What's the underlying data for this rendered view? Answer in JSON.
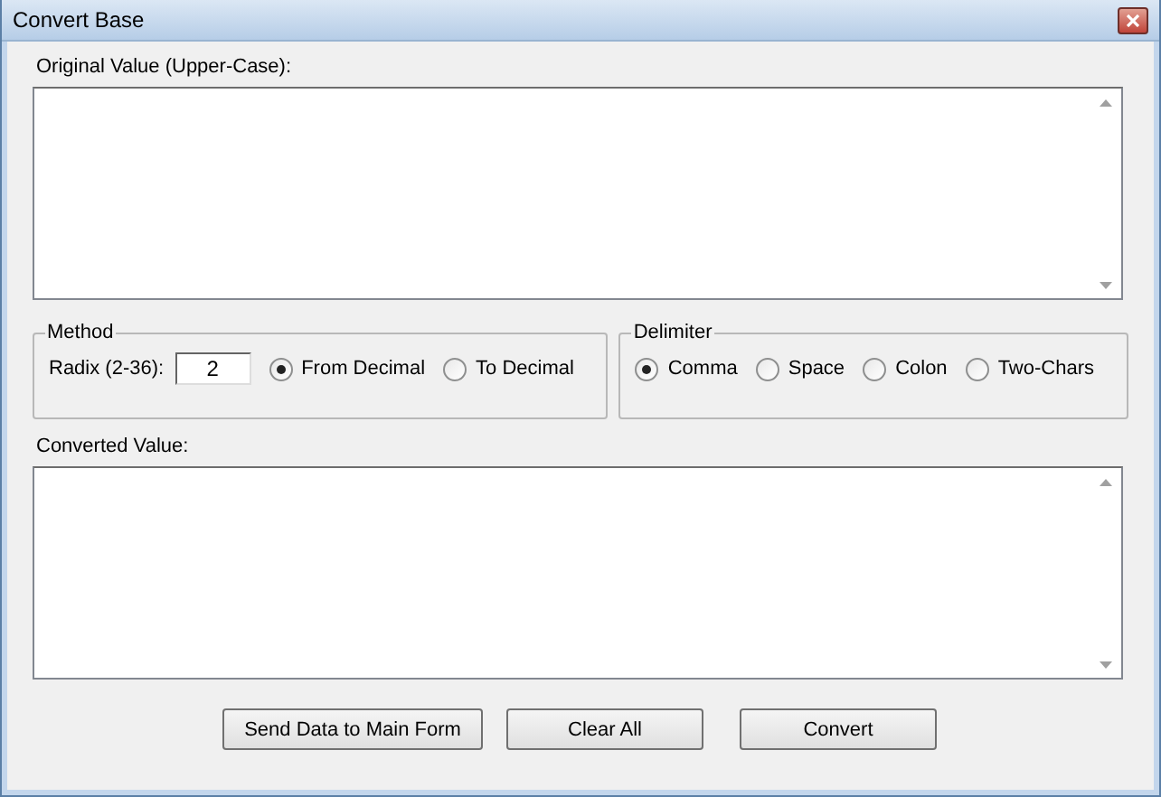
{
  "window": {
    "title": "Convert Base"
  },
  "original": {
    "label": "Original Value (Upper-Case):"
  },
  "method": {
    "title": "Method",
    "radix_label": "Radix (2-36):",
    "radix_value": "2",
    "options": [
      {
        "label": "From Decimal",
        "selected": true
      },
      {
        "label": "To Decimal",
        "selected": false
      }
    ]
  },
  "delimiter": {
    "title": "Delimiter",
    "options": [
      {
        "label": "Comma",
        "selected": true
      },
      {
        "label": "Space",
        "selected": false
      },
      {
        "label": "Colon",
        "selected": false
      },
      {
        "label": "Two-Chars",
        "selected": false
      }
    ]
  },
  "converted": {
    "label": "Converted Value:"
  },
  "buttons": [
    "Send Data to Main Form",
    "Clear All",
    "Convert"
  ]
}
